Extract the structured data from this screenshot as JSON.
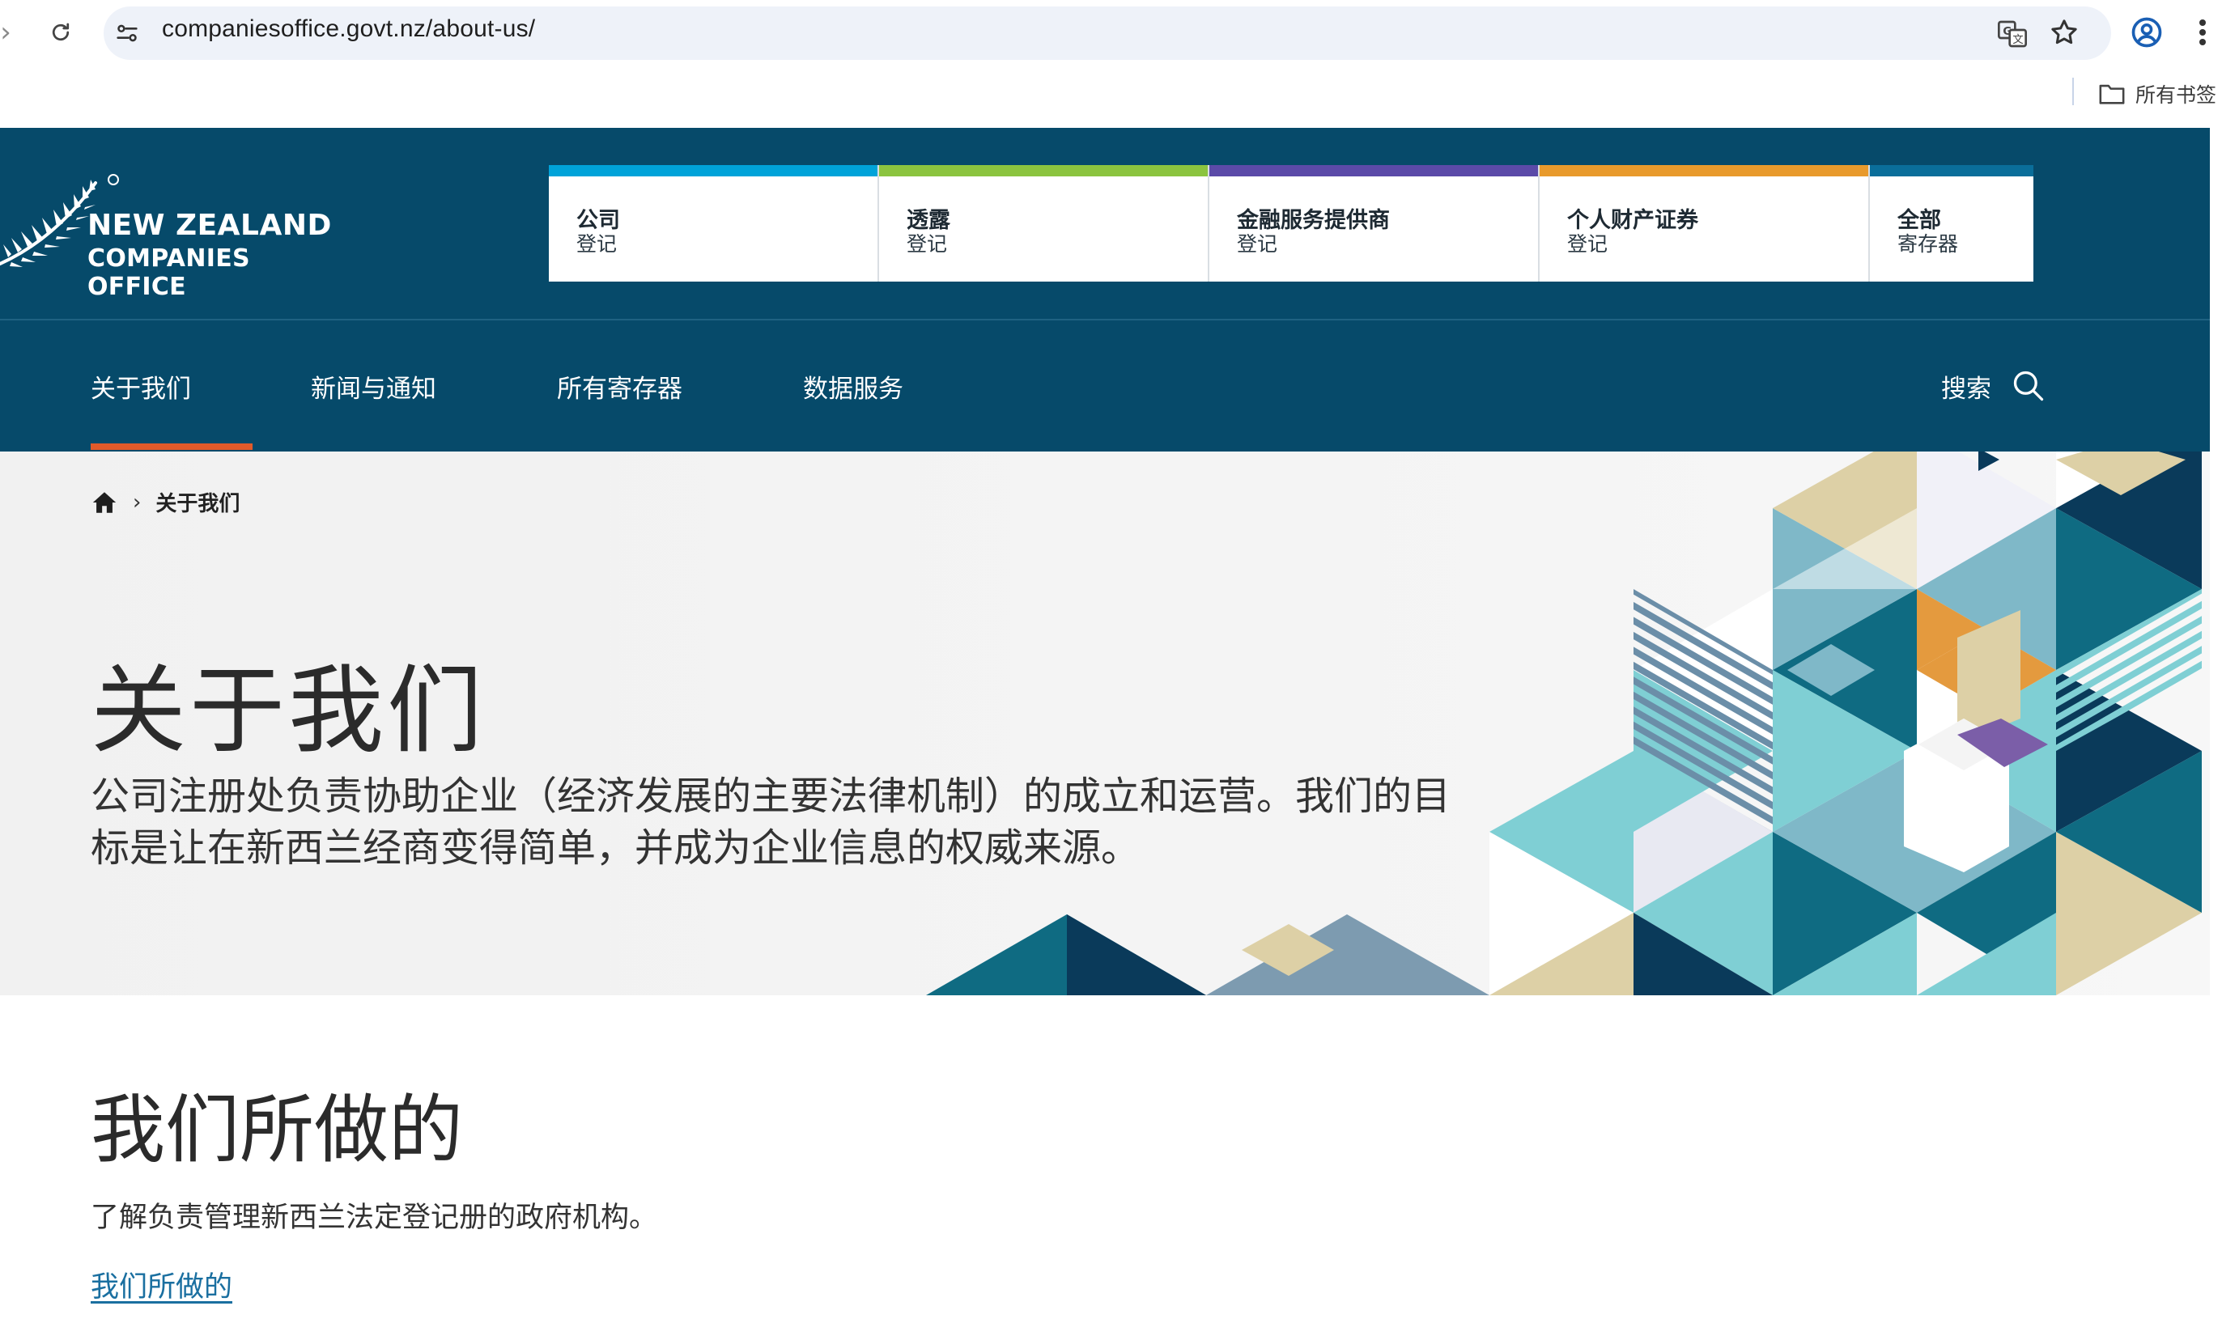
{
  "browser": {
    "url": "companiesoffice.govt.nz/about-us/",
    "bookmarks_label": "所有书签"
  },
  "logo": {
    "line1": "NEW ZEALAND",
    "line2": "COMPANIES OFFICE"
  },
  "registers": [
    {
      "title": "公司",
      "subtitle": "登记",
      "color": "#00a3d9"
    },
    {
      "title": "透露",
      "subtitle": "登记",
      "color": "#8bc43f"
    },
    {
      "title": "金融服务提供商",
      "subtitle": "登记",
      "color": "#5b4aa8"
    },
    {
      "title": "个人财产证券",
      "subtitle": "登记",
      "color": "#e89a2c"
    },
    {
      "title": "全部",
      "subtitle": "寄存器",
      "color": "#0a6e9a"
    }
  ],
  "nav": {
    "items": [
      "关于我们",
      "新闻与通知",
      "所有寄存器",
      "数据服务"
    ],
    "search_label": "搜索"
  },
  "breadcrumb": {
    "separator": "›",
    "current": "关于我们"
  },
  "hero": {
    "title": "关于我们",
    "description": "公司注册处负责协助企业（经济发展的主要法律机制）的成立和运营。我们的目标是让在新西兰经商变得简单，并成为企业信息的权威来源。"
  },
  "section": {
    "title": "我们所做的",
    "text": "了解负责管理新西兰法定登记册的政府机构。",
    "link": "我们所做的"
  },
  "colors": {
    "header_bg": "#064a6a",
    "active_underline": "#e05a2a",
    "link": "#1a6fa0"
  }
}
